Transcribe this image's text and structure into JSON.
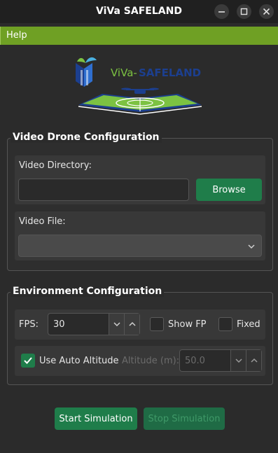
{
  "window": {
    "title": "ViVa SAFELAND"
  },
  "menu": {
    "help": "Help"
  },
  "logo": {
    "text_viva": "ViVa-",
    "text_safeland": "SAFELAND"
  },
  "video_group": {
    "title": "Video Drone Configuration",
    "directory_label": "Video Directory:",
    "directory_value": "",
    "browse_label": "Browse",
    "file_label": "Video File:",
    "file_value": ""
  },
  "env_group": {
    "title": "Environment Configuration",
    "fps_label": "FPS:",
    "fps_value": "30",
    "show_fp_label": "Show FP",
    "show_fp_checked": false,
    "fixed_label": "Fixed",
    "fixed_checked": false,
    "auto_altitude_label": "Use Auto Altitude",
    "auto_altitude_checked": true,
    "altitude_label": "Altitude (m):",
    "altitude_value": "50.0"
  },
  "actions": {
    "start_label": "Start Simulation",
    "stop_label": "Stop Simulation"
  },
  "colors": {
    "menubar": "#6fa024",
    "accent_button": "#1f7d4a",
    "background": "#2b2b2b",
    "logo_blue": "#1c3f8f",
    "logo_green": "#7cc242"
  }
}
